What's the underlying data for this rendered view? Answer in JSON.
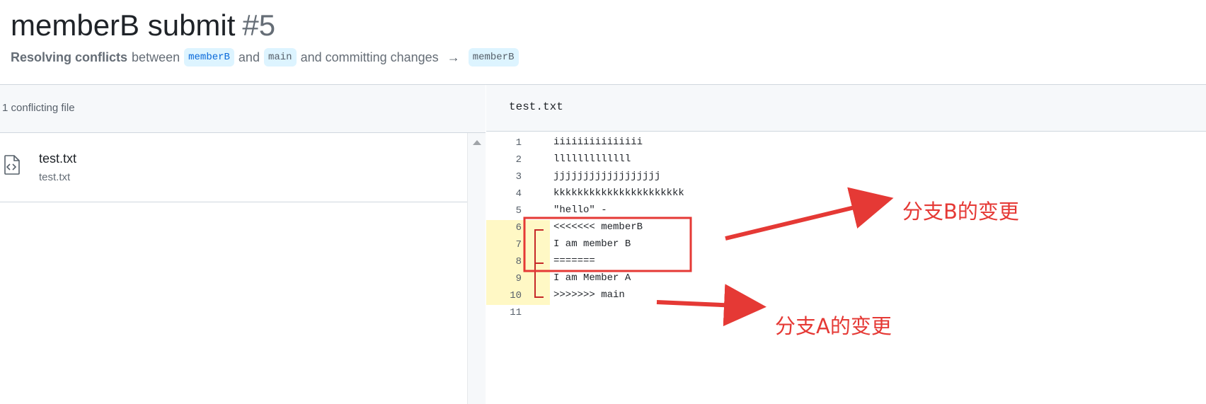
{
  "pr": {
    "title": "memberB submit",
    "number": "#5",
    "subtitle": {
      "strong": "Resolving conflicts",
      "between": "between",
      "head_branch": "memberB",
      "and": "and",
      "base_branch": "main",
      "action": "and committing changes",
      "arrow": "→",
      "target_branch": "memberB"
    }
  },
  "files_panel": {
    "header": "1 conflicting file",
    "files": [
      {
        "name": "test.txt",
        "path": "test.txt",
        "icon": "file-code-icon"
      }
    ]
  },
  "editor": {
    "filename": "test.txt",
    "conflict_highlight_color": "#fff8c5",
    "lines": [
      {
        "n": "1",
        "text": "iiiiiiiiiiiiiii",
        "conflict": false
      },
      {
        "n": "2",
        "text": "lllllllllllll",
        "conflict": false
      },
      {
        "n": "3",
        "text": "jjjjjjjjjjjjjjjjjj",
        "conflict": false
      },
      {
        "n": "4",
        "text": "kkkkkkkkkkkkkkkkkkkkkk",
        "conflict": false
      },
      {
        "n": "5",
        "text": "\"hello\" -",
        "conflict": false
      },
      {
        "n": "6",
        "text": "<<<<<<< memberB",
        "conflict": true
      },
      {
        "n": "7",
        "text": "I am member B",
        "conflict": true
      },
      {
        "n": "8",
        "text": "=======",
        "conflict": true
      },
      {
        "n": "9",
        "text": "I am Member A",
        "conflict": true
      },
      {
        "n": "10",
        "text": ">>>>>>> main",
        "conflict": true
      },
      {
        "n": "11",
        "text": "",
        "conflict": false
      }
    ]
  },
  "annotations": {
    "color": "#e53935",
    "branch_b_note": "分支B的变更",
    "branch_a_note": "分支A的变更"
  }
}
